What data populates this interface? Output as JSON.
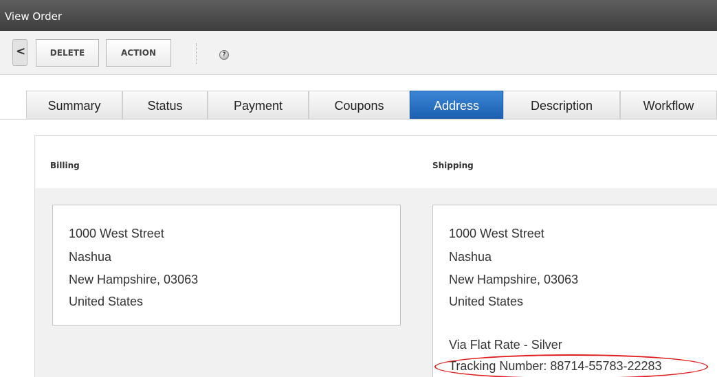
{
  "window": {
    "title": "View Order"
  },
  "toolbar": {
    "back_label": "<",
    "delete_label": "DELETE",
    "action_label": "ACTION"
  },
  "tabs": [
    {
      "label": "Summary",
      "active": false
    },
    {
      "label": "Status",
      "active": false
    },
    {
      "label": "Payment",
      "active": false
    },
    {
      "label": "Coupons",
      "active": false
    },
    {
      "label": "Address",
      "active": true
    },
    {
      "label": "Description",
      "active": false
    },
    {
      "label": "Workflow",
      "active": false
    }
  ],
  "billing": {
    "heading": "Billing",
    "lines": [
      "1000 West Street",
      "Nashua",
      "New Hampshire, 03063",
      "United States"
    ]
  },
  "shipping": {
    "heading": "Shipping",
    "lines": [
      "1000 West Street",
      "Nashua",
      "New Hampshire, 03063",
      "United States"
    ],
    "method": "Via Flat Rate - Silver",
    "tracking": "Tracking Number: 88714-55783-22283"
  },
  "colors": {
    "active_tab": "#1b5fb0",
    "highlight": "#e01c1c",
    "titlebar": "#4a4a4a"
  },
  "icons": {
    "help": "help-icon",
    "back": "chevron-left-icon"
  }
}
